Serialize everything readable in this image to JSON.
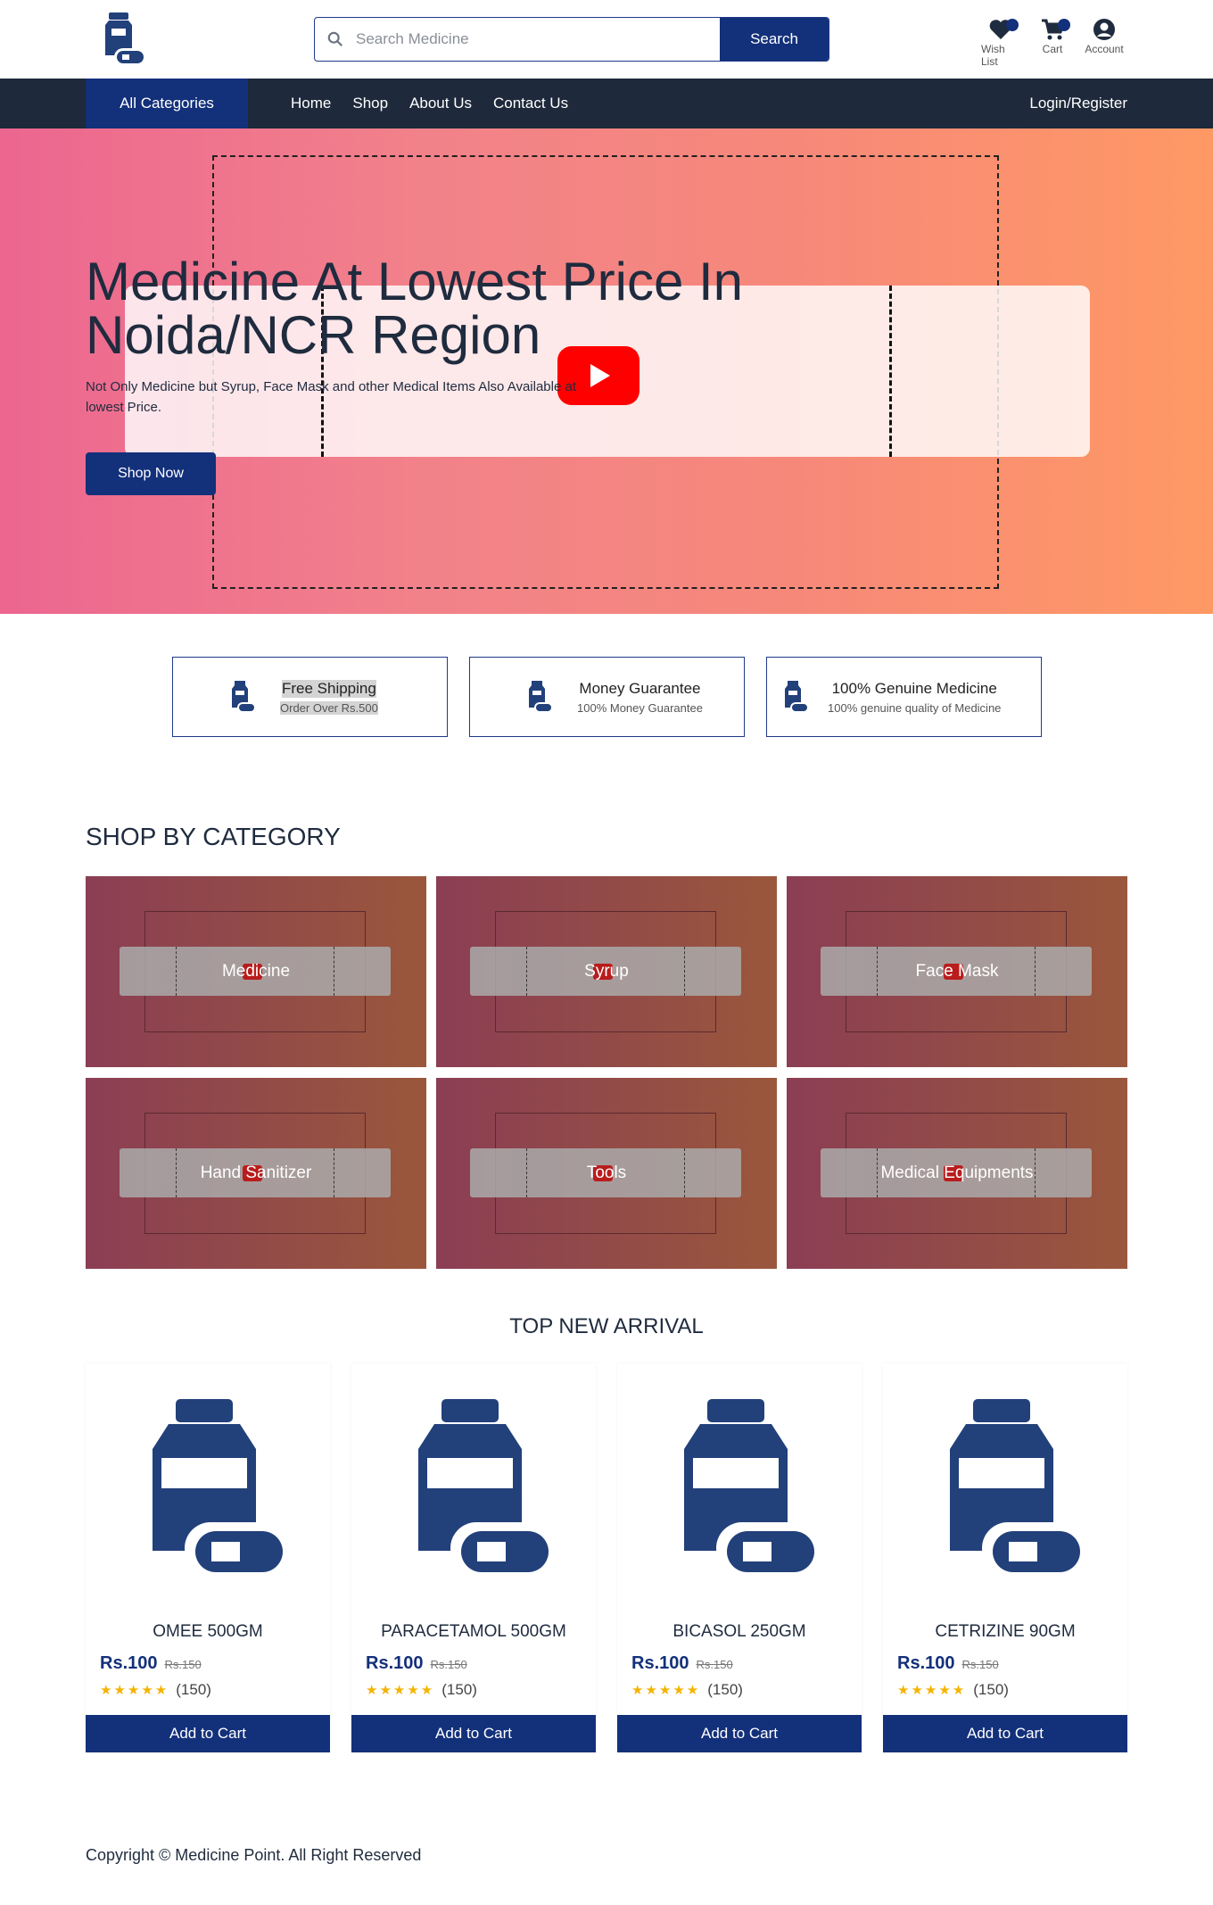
{
  "header": {
    "search_placeholder": "Search Medicine",
    "search_button": "Search",
    "icons": [
      {
        "icon": "heart-icon",
        "label": "Wish List"
      },
      {
        "icon": "cart-icon",
        "label": "Cart"
      },
      {
        "icon": "account-icon",
        "label": "Account"
      }
    ]
  },
  "nav": {
    "all_categories": "All Categories",
    "links": [
      "Home",
      "Shop",
      "About Us",
      "Contact Us"
    ],
    "login": "Login/Register"
  },
  "hero": {
    "title": "Medicine At Lowest Price In Noida/NCR Region",
    "subtitle": "Not Only Medicine but Syrup, Face Mask and other Medical Items Also Available at lowest Price.",
    "cta": "Shop Now"
  },
  "features": [
    {
      "title": "Free Shipping",
      "sub": "Order Over Rs.500"
    },
    {
      "title": "Money Guarantee",
      "sub": "100% Money Guarantee"
    },
    {
      "title": "100% Genuine Medicine",
      "sub": "100% genuine quality of Medicine"
    }
  ],
  "categories": {
    "title": "SHOP BY CATEGORY",
    "items": [
      "Medicine",
      "Syrup",
      "Face Mask",
      "Hand Sanitizer",
      "Tools",
      "Medical Equipments"
    ]
  },
  "arrivals": {
    "title": "TOP NEW ARRIVAL",
    "products": [
      {
        "name": "OMEE 500GM",
        "price": "Rs.100",
        "old_price": "Rs.150",
        "reviews": "(150)",
        "cta": "Add to Cart"
      },
      {
        "name": "PARACETAMOL 500GM",
        "price": "Rs.100",
        "old_price": "Rs.150",
        "reviews": "(150)",
        "cta": "Add to Cart"
      },
      {
        "name": "BICASOL 250GM",
        "price": "Rs.100",
        "old_price": "Rs.150",
        "reviews": "(150)",
        "cta": "Add to Cart"
      },
      {
        "name": "CETRIZINE 90GM",
        "price": "Rs.100",
        "old_price": "Rs.150",
        "reviews": "(150)",
        "cta": "Add to Cart"
      }
    ]
  },
  "footer": {
    "copyright": "Copyright © Medicine Point. All Right Reserved"
  },
  "colors": {
    "primary": "#13307a",
    "nav_bg": "#1e293b",
    "star": "#f5b301"
  }
}
